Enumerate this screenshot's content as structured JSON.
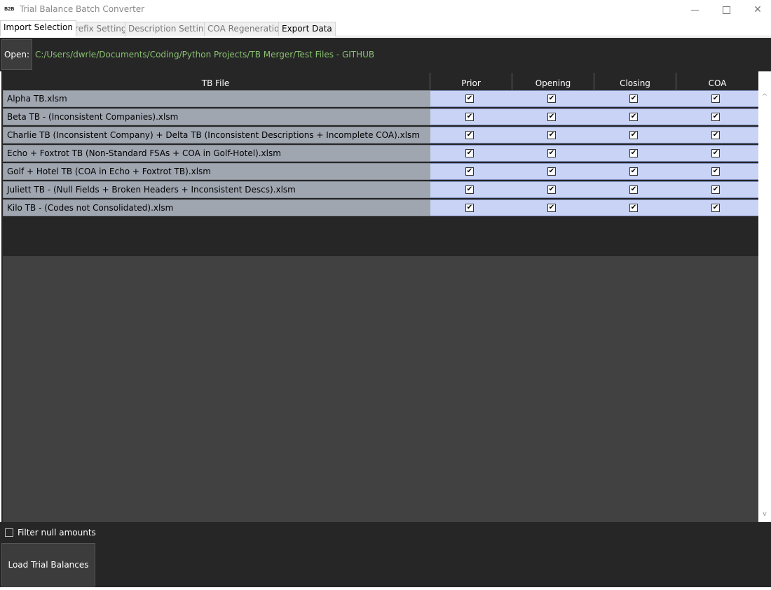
{
  "window": {
    "icon_text": "B2B",
    "title": "Trial Balance Batch Converter",
    "minimize_symbol": "",
    "close_symbol": "✕"
  },
  "tabs": [
    {
      "label": "Import Selection",
      "active": true
    },
    {
      "label": "Prefix Settings",
      "active": false
    },
    {
      "label": "Description Settings",
      "active": false
    },
    {
      "label": "COA Regeneration",
      "active": false
    },
    {
      "label": "Export Data",
      "active": false
    }
  ],
  "open_bar": {
    "button_label": "Open:",
    "path": "C:/Users/dwrle/Documents/Coding/Python Projects/TB Merger/Test Files - GITHUB"
  },
  "table": {
    "headers": [
      "TB File",
      "Prior",
      "Opening",
      "Closing",
      "COA"
    ],
    "rows": [
      {
        "file": "Alpha TB.xlsm",
        "prior": true,
        "opening": true,
        "closing": true,
        "coa": true
      },
      {
        "file": "Beta TB - (Inconsistent Companies).xlsm",
        "prior": true,
        "opening": true,
        "closing": true,
        "coa": true
      },
      {
        "file": "Charlie TB (Inconsistent Company) + Delta TB (Inconsistent Descriptions + Incomplete COA).xlsm",
        "prior": true,
        "opening": true,
        "closing": true,
        "coa": true
      },
      {
        "file": "Echo + Foxtrot TB (Non-Standard FSAs + COA in Golf-Hotel).xlsm",
        "prior": true,
        "opening": true,
        "closing": true,
        "coa": true
      },
      {
        "file": "Golf + Hotel TB (COA in Echo + Foxtrot TB).xlsm",
        "prior": true,
        "opening": true,
        "closing": true,
        "coa": true
      },
      {
        "file": "Juliett TB - (Null Fields + Broken Headers + Inconsistent Descs).xlsm",
        "prior": true,
        "opening": true,
        "closing": true,
        "coa": true
      },
      {
        "file": "Kilo TB - (Codes not Consolidated).xlsm",
        "prior": true,
        "opening": true,
        "closing": true,
        "coa": true
      }
    ],
    "checkmark": "✔"
  },
  "scroll": {
    "up": "^",
    "down": "v"
  },
  "bottom": {
    "filter_label": "Filter null amounts",
    "filter_checked": false,
    "load_button": "Load Trial Balances"
  },
  "colors": {
    "dark_bg": "#262626",
    "file_cell": "#a0a6b0",
    "check_cell": "#c8d3f5",
    "path_text": "#88c070"
  }
}
